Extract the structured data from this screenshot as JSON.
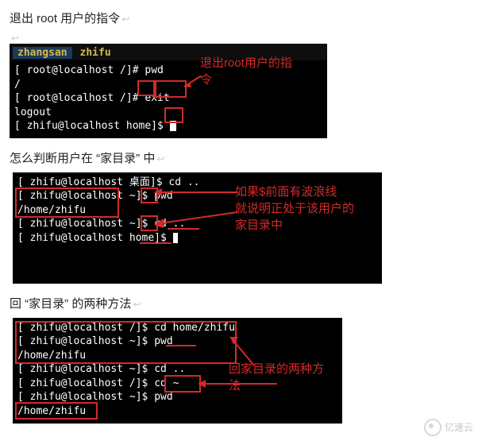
{
  "headings": {
    "h1": "退出 root 用户的指令",
    "h2": "怎么判断用户在 “家目录” 中",
    "h3": "回 “家目录” 的两种方法"
  },
  "annotations": {
    "a1_line1": "退出root用户的指",
    "a1_line2": "令",
    "a2_line1": "如果$前面有波浪线",
    "a2_line2": "就说明正处于该用户的",
    "a2_line3": "家目录中",
    "a3_line1": "回家目录的两种方",
    "a3_line2": "法"
  },
  "terminals": {
    "t1": {
      "tabs": [
        "zhangsan",
        "zhifu"
      ],
      "lines": [
        {
          "prompt": "[ root@localhost /]# ",
          "cmd": "pwd"
        },
        {
          "plain": "/"
        },
        {
          "prompt": "[ root@localhost /]# ",
          "cmd": "exit"
        },
        {
          "plain": "logout"
        },
        {
          "prompt_g": "[ zhifu@localhost home]",
          "dollar": "$ ",
          "cursor": true
        }
      ]
    },
    "t2": {
      "lines": [
        {
          "prompt_g": "[ zhifu@localhost 桌面]$ ",
          "cmd": "cd .."
        },
        {
          "prompt_g": "[ zhifu@localhost ~]$ ",
          "cmd": "pwd"
        },
        {
          "plain": "/home/zhifu"
        },
        {
          "prompt_g": "[ zhifu@localhost ~]$ ",
          "cmd": "cd .."
        },
        {
          "prompt_g": "[ zhifu@localhost home]$ ",
          "cursor": true
        }
      ]
    },
    "t3": {
      "lines": [
        {
          "prompt_g": "[ zhifu@localhost /]$ ",
          "cmd": "cd home/zhifu"
        },
        {
          "prompt_g": "[ zhifu@localhost ~]$ ",
          "cmd": "pwd"
        },
        {
          "plain": "/home/zhifu"
        },
        {
          "prompt_g": "[ zhifu@localhost ~]$ ",
          "cmd": "cd .."
        },
        {
          "prompt_g": "[ zhifu@localhost /]$ ",
          "cmd": "cd ~"
        },
        {
          "prompt_g": "[ zhifu@localhost ~]$ ",
          "cmd": "pwd"
        },
        {
          "plain": "/home/zhifu"
        }
      ]
    }
  },
  "watermark": "亿速云"
}
